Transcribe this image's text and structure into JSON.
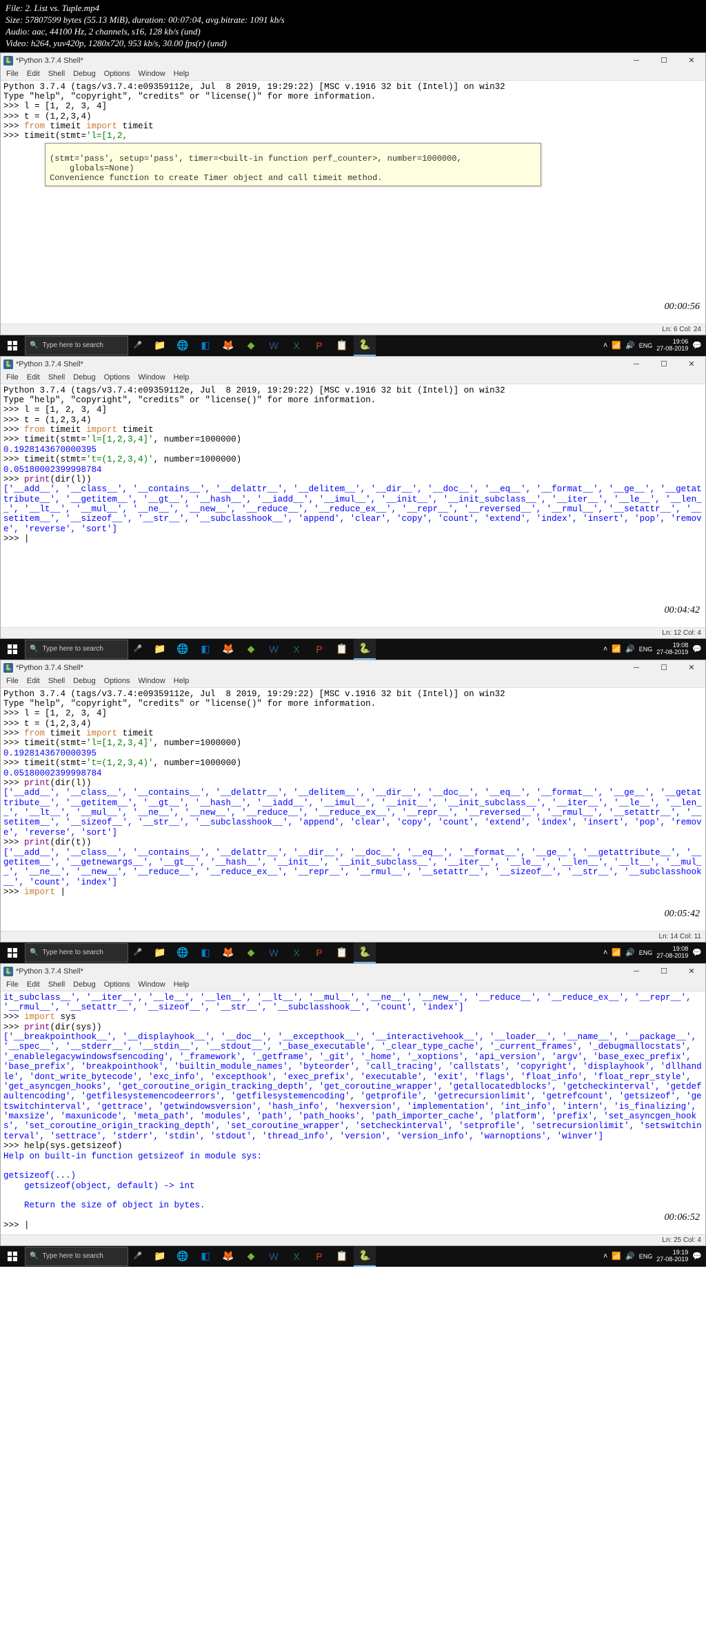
{
  "video": {
    "file": "File: 2. List vs. Tuple.mp4",
    "size": "Size: 57807599 bytes (55.13 MiB), duration: 00:07:04, avg.bitrate: 1091 kb/s",
    "audio": "Audio: aac, 44100 Hz, 2 channels, s16, 128 kb/s (und)",
    "video_line": "Video: h264, yuv420p, 1280x720, 953 kb/s, 30.00 fps(r) (und)",
    "ts1": "00:00:56",
    "ts2": "00:04:42",
    "ts3": "00:05:42",
    "ts4": "00:06:52"
  },
  "shell_title": "*Python 3.7.4 Shell*",
  "menu": [
    "File",
    "Edit",
    "Shell",
    "Debug",
    "Options",
    "Window",
    "Help"
  ],
  "header_line1": "Python 3.7.4 (tags/v3.7.4:e09359112e, Jul  8 2019, 19:29:22) [MSC v.1916 32 bit (Intel)] on win32",
  "header_line2": "Type \"help\", \"copyright\", \"credits\" or \"license()\" for more information.",
  "code": {
    "l_assign": "l = [1, 2, 3, 4]",
    "t_assign": "t = (1,2,3,4)",
    "from_timeit": "from timeit import timeit",
    "timeit_partial": "timeit(stmt='l=[1,2,",
    "timeit_l": "timeit(stmt='l=[1,2,3,4]', number=1000000)",
    "timeit_l_result": "0.1928143670000395",
    "timeit_t": "timeit(stmt='t=(1,2,3,4)', number=1000000)",
    "timeit_t_result": "0.05180002399998784",
    "print_dir_l": "print(dir(l))",
    "print_dir_t": "print(dir(t))",
    "import_partial": "import ",
    "import_sys": "import sys",
    "print_dir_sys": "print(dir(sys))",
    "help_getsizeof": "help(sys.getsizeof)"
  },
  "tooltip": {
    "line1": "(stmt='pass', setup='pass', timer=<built-in function perf_counter>, number=1000000,",
    "line2": "    globals=None)",
    "line3": "Convenience function to create Timer object and call timeit method."
  },
  "dir_l_output": "['__add__', '__class__', '__contains__', '__delattr__', '__delitem__', '__dir__', '__doc__', '__eq__', '__format__', '__ge__', '__getattribute__', '__getitem__', '__gt__', '__hash__', '__iadd__', '__imul__', '__init__', '__init_subclass__', '__iter__', '__le__', '__len__', '__lt__', '__mul__', '__ne__', '__new__', '__reduce__', '__reduce_ex__', '__repr__', '__reversed__', '__rmul__', '__setattr__', '__setitem__', '__sizeof__', '__str__', '__subclasshook__', 'append', 'clear', 'copy', 'count', 'extend', 'index', 'insert', 'pop', 'remove', 'reverse', 'sort']",
  "dir_t_output": "['__add__', '__class__', '__contains__', '__delattr__', '__dir__', '__doc__', '__eq__', '__format__', '__ge__', '__getattribute__', '__getitem__', '__getnewargs__', '__gt__', '__hash__', '__init__', '__init_subclass__', '__iter__', '__le__', '__len__', '__lt__', '__mul__', '__ne__', '__new__', '__reduce__', '__reduce_ex__', '__repr__', '__rmul__', '__setattr__', '__sizeof__', '__str__', '__subclasshook__', 'count', 'index']",
  "frame4_top": "it_subclass__', '__iter__', '__le__', '__len__', '__lt__', '__mul__', '__ne__', '__new__', '__reduce__', '__reduce_ex__', '__repr__', '__rmul__', '__setattr__', '__sizeof__', '__str__', '__subclasshook__', 'count', 'index']",
  "dir_sys_output": "['__breakpointhook__', '__displayhook__', '__doc__', '__excepthook__', '__interactivehook__', '__loader__', '__name__', '__package__', '__spec__', '__stderr__', '__stdin__', '__stdout__', '_base_executable', '_clear_type_cache', '_current_frames', '_debugmallocstats', '_enablelegacywindowsfsencoding', '_framework', '_getframe', '_git', '_home', '_xoptions', 'api_version', 'argv', 'base_exec_prefix', 'base_prefix', 'breakpointhook', 'builtin_module_names', 'byteorder', 'call_tracing', 'callstats', 'copyright', 'displayhook', 'dllhandle', 'dont_write_bytecode', 'exc_info', 'excepthook', 'exec_prefix', 'executable', 'exit', 'flags', 'float_info', 'float_repr_style', 'get_asyncgen_hooks', 'get_coroutine_origin_tracking_depth', 'get_coroutine_wrapper', 'getallocatedblocks', 'getcheckinterval', 'getdefaultencoding', 'getfilesystemencodeerrors', 'getfilesystemencoding', 'getprofile', 'getrecursionlimit', 'getrefcount', 'getsizeof', 'getswitchinterval', 'gettrace', 'getwindowsversion', 'hash_info', 'hexversion', 'implementation', 'int_info', 'intern', 'is_finalizing', 'maxsize', 'maxunicode', 'meta_path', 'modules', 'path', 'path_hooks', 'path_importer_cache', 'platform', 'prefix', 'set_asyncgen_hooks', 'set_coroutine_origin_tracking_depth', 'set_coroutine_wrapper', 'setcheckinterval', 'setprofile', 'setrecursionlimit', 'setswitchinterval', 'settrace', 'stderr', 'stdin', 'stdout', 'thread_info', 'version', 'version_info', 'warnoptions', 'winver']",
  "help_output": {
    "l1": "Help on built-in function getsizeof in module sys:",
    "l2": "getsizeof(...)",
    "l3": "    getsizeof(object, default) -> int",
    "l4": "    Return the size of object in bytes."
  },
  "status": {
    "s1": "Ln: 6  Col: 24",
    "s2": "Ln: 12  Col: 4",
    "s3": "Ln: 14  Col: 11",
    "s4": "Ln: 25  Col: 4"
  },
  "taskbar": {
    "search_placeholder": "Type here to search",
    "clock": [
      {
        "time": "19:06",
        "date": "27-08-2019"
      },
      {
        "time": "19:08",
        "date": "27-08-2019"
      },
      {
        "time": "19:08",
        "date": "27-08-2019"
      },
      {
        "time": "19:19",
        "date": "27-08-2019"
      }
    ],
    "lang": "ENG",
    "net": "⬆"
  }
}
